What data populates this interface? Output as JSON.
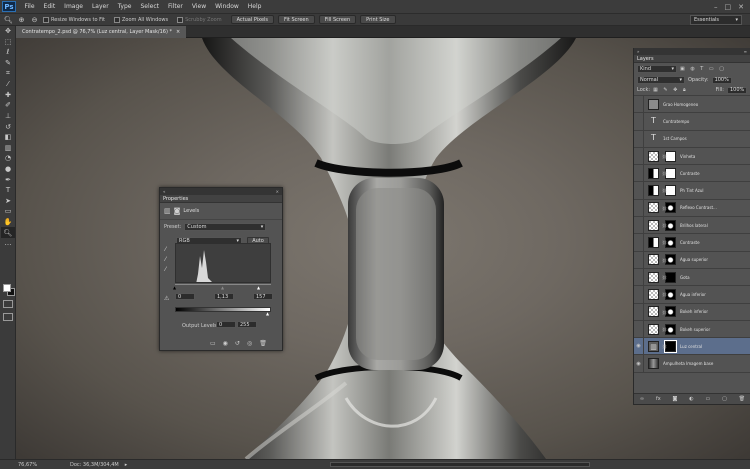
{
  "app": {
    "logo": "Ps",
    "menu": [
      "File",
      "Edit",
      "Image",
      "Layer",
      "Type",
      "Select",
      "Filter",
      "View",
      "Window",
      "Help"
    ]
  },
  "options": {
    "resize_windows": "Resize Windows to Fit",
    "zoom_all_windows": "Zoom All Windows",
    "scrubby_zoom": "Scrubby Zoom",
    "buttons": [
      "Actual Pixels",
      "Fit Screen",
      "Fill Screen",
      "Print Size"
    ],
    "workspace": "Essentials"
  },
  "document": {
    "tab_title": "Contratempo_2.psd @ 76,7% (Luz central, Layer Mask/16) *"
  },
  "status": {
    "zoom": "76,67%",
    "doc": "Doc: 36,3M/304,4M"
  },
  "properties": {
    "title": "Properties",
    "tab": "Levels",
    "preset_label": "Preset:",
    "preset_value": "Custom",
    "channel": "RGB",
    "auto": "Auto",
    "input_black": "0",
    "input_mid": "1,13",
    "input_white": "157",
    "output_label": "Output Levels:",
    "output_black": "0",
    "output_white": "255"
  },
  "layers": {
    "title": "Layers",
    "kind": "Kind",
    "blend": "Normal",
    "opacity_label": "Opacity:",
    "opacity": "100%",
    "lock_label": "Lock:",
    "fill_label": "Fill:",
    "fill": "100%",
    "items": [
      {
        "name": "Grao Homogeneo",
        "thumb": "gray",
        "mask": false,
        "visible": false,
        "selected": false
      },
      {
        "name": "Contratempo",
        "thumb": "type",
        "mask": false,
        "visible": false,
        "selected": false
      },
      {
        "name": "1st Campos",
        "thumb": "type",
        "mask": false,
        "visible": false,
        "selected": false
      },
      {
        "name": "Vinheta",
        "thumb": "checker",
        "mask": "white",
        "visible": false,
        "selected": false
      },
      {
        "name": "Contraste",
        "thumb": "adjust",
        "mask": "white",
        "visible": false,
        "selected": false
      },
      {
        "name": "Ph Tint Azul",
        "thumb": "adjust",
        "mask": "white",
        "visible": false,
        "selected": false
      },
      {
        "name": "Reflexo Contrast...",
        "thumb": "checker",
        "mask": "blob",
        "visible": false,
        "selected": false
      },
      {
        "name": "Brilhos lateral",
        "thumb": "checker",
        "mask": "blob",
        "visible": false,
        "selected": false
      },
      {
        "name": "Contraste",
        "thumb": "adjust",
        "mask": "blob",
        "visible": false,
        "selected": false
      },
      {
        "name": "Agua superior",
        "thumb": "checker",
        "mask": "blob",
        "visible": false,
        "selected": false
      },
      {
        "name": "Gota",
        "thumb": "checker",
        "mask": "black",
        "visible": false,
        "selected": false
      },
      {
        "name": "Agua inferior",
        "thumb": "checker",
        "mask": "blob",
        "visible": false,
        "selected": false
      },
      {
        "name": "Bokeh inferior",
        "thumb": "blue",
        "mask": "blob",
        "visible": false,
        "selected": false
      },
      {
        "name": "Bokeh superior",
        "thumb": "blue",
        "mask": "blob",
        "visible": false,
        "selected": false
      },
      {
        "name": "Luz central",
        "thumb": "levels",
        "mask": "black",
        "visible": true,
        "selected": true
      },
      {
        "name": "Ampulheta Imagem base",
        "thumb": "photo",
        "mask": false,
        "visible": true,
        "selected": false
      }
    ]
  }
}
